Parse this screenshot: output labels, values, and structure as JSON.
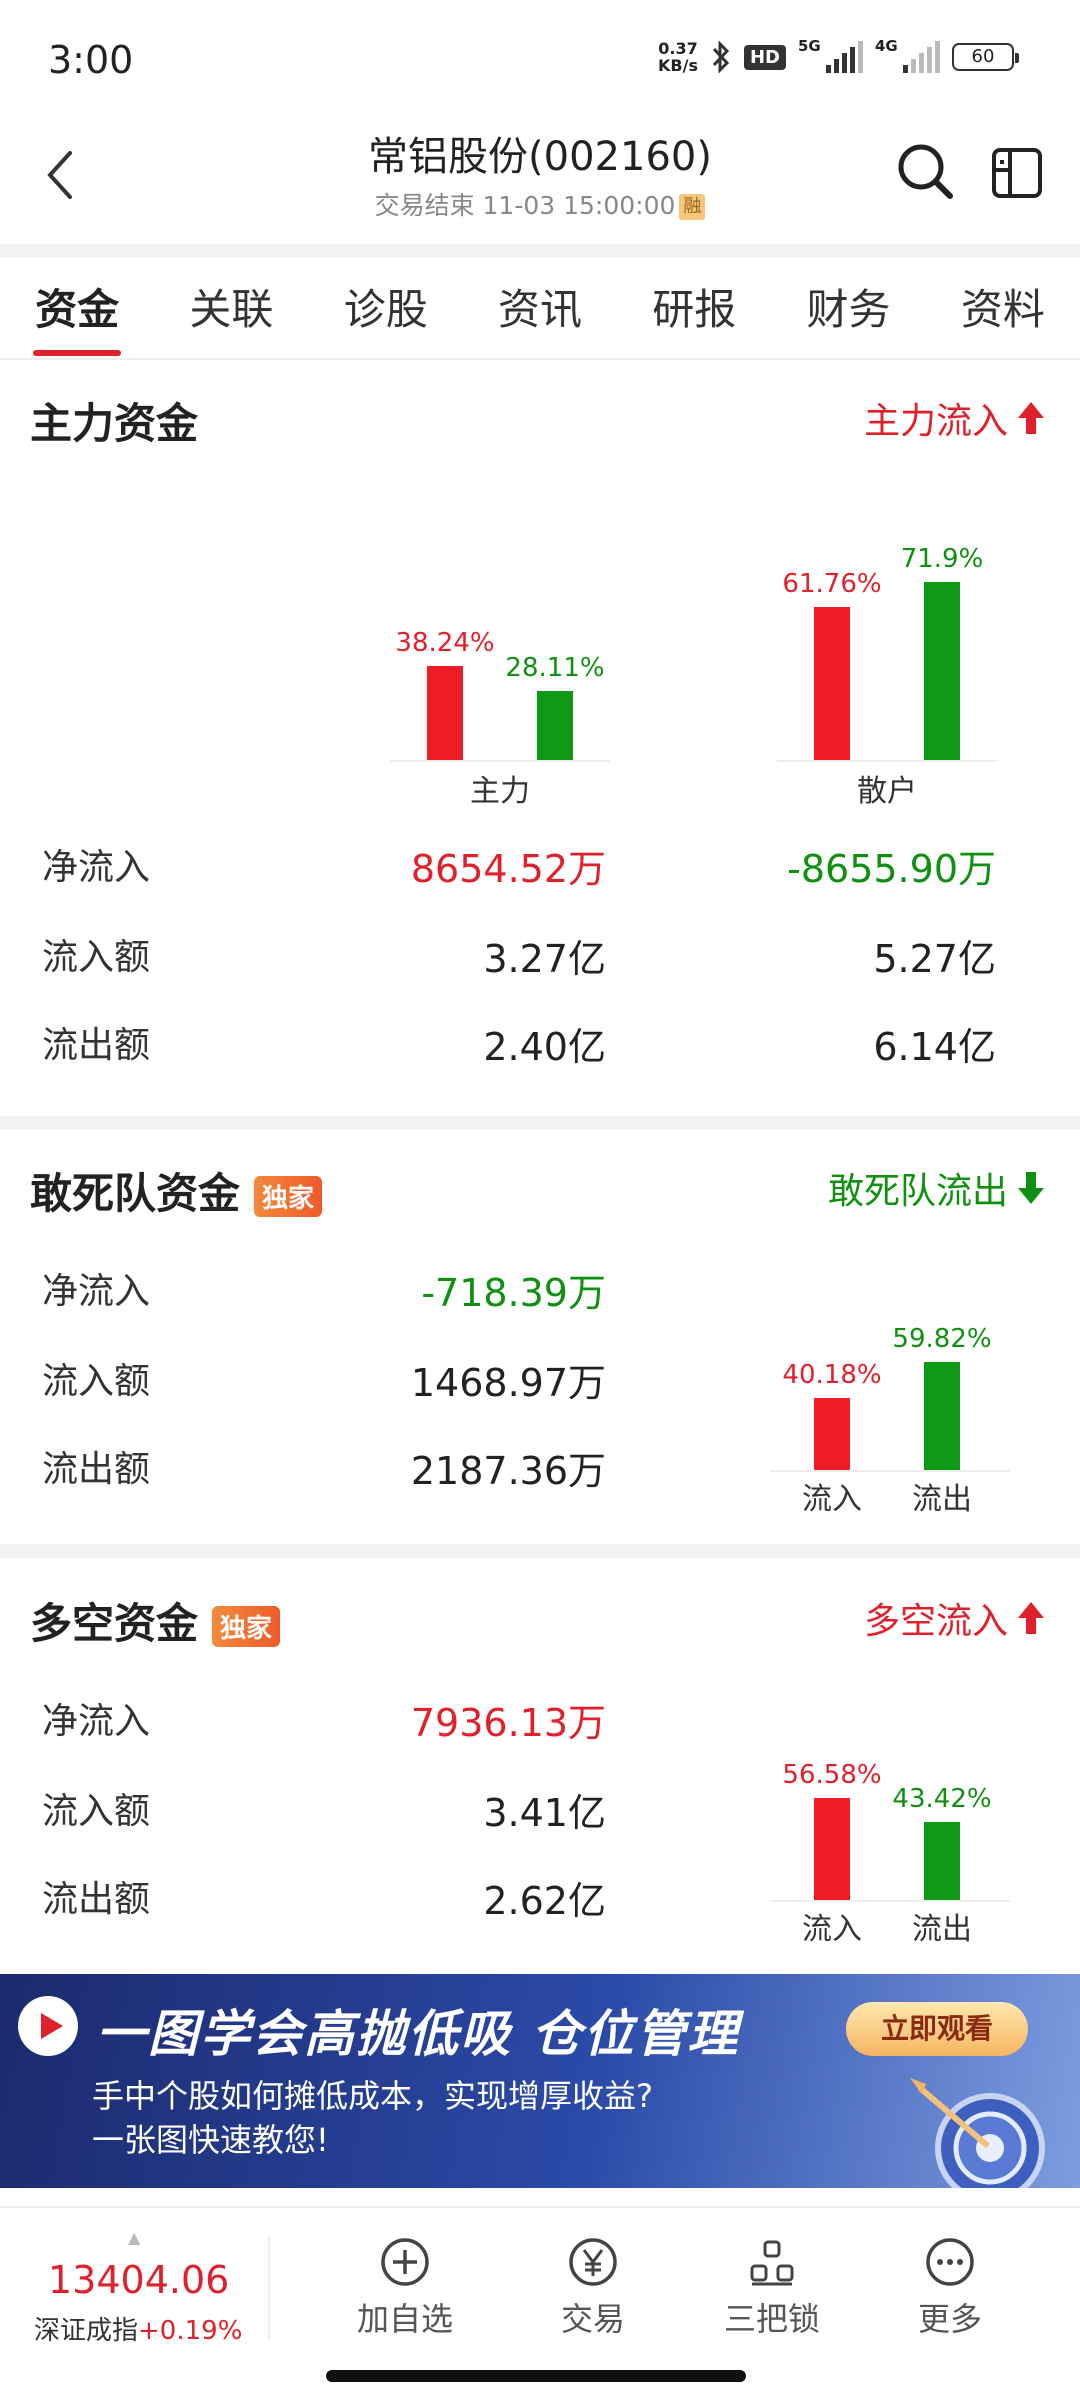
{
  "status_bar": {
    "time": "3:00",
    "net_speed": "0.37",
    "net_unit": "KB/s",
    "hd_label": "HD",
    "sim1": "5G",
    "sim2": "4G",
    "battery": "60"
  },
  "header": {
    "title": "常铝股份(002160)",
    "subtitle": "交易结束 11-03 15:00:00",
    "rong_badge": "融"
  },
  "tabs": [
    "资金",
    "关联",
    "诊股",
    "资讯",
    "研报",
    "财务",
    "资料"
  ],
  "main_fund": {
    "title": "主力资金",
    "flow_label": "主力流入",
    "chart_data": {
      "type": "bar",
      "categories": [
        "主力",
        "散户"
      ],
      "series": [
        {
          "values": [
            38.24,
            61.76
          ],
          "color": "#ee1c24"
        },
        {
          "values": [
            28.11,
            71.9
          ],
          "color": "#0e9a16"
        }
      ],
      "labels": [
        [
          "38.24%",
          "28.11%"
        ],
        [
          "61.76%",
          "71.9%"
        ]
      ]
    },
    "rows": [
      {
        "label": "净流入",
        "main": "8654.52万",
        "retail": "-8655.90万"
      },
      {
        "label": "流入额",
        "main": "3.27亿",
        "retail": "5.27亿"
      },
      {
        "label": "流出额",
        "main": "2.40亿",
        "retail": "6.14亿"
      }
    ]
  },
  "dare_fund": {
    "title": "敢死队资金",
    "badge": "独家",
    "flow_label": "敢死队流出",
    "rows": [
      {
        "label": "净流入",
        "value": "-718.39万"
      },
      {
        "label": "流入额",
        "value": "1468.97万"
      },
      {
        "label": "流出额",
        "value": "2187.36万"
      }
    ],
    "chart_data": {
      "type": "bar",
      "categories": [
        "流入",
        "流出"
      ],
      "values": [
        40.18,
        59.82
      ],
      "labels": [
        "40.18%",
        "59.82%"
      ]
    }
  },
  "longshort_fund": {
    "title": "多空资金",
    "badge": "独家",
    "flow_label": "多空流入",
    "rows": [
      {
        "label": "净流入",
        "value": "7936.13万"
      },
      {
        "label": "流入额",
        "value": "3.41亿"
      },
      {
        "label": "流出额",
        "value": "2.62亿"
      }
    ],
    "chart_data": {
      "type": "bar",
      "categories": [
        "流入",
        "流出"
      ],
      "values": [
        56.58,
        43.42
      ],
      "labels": [
        "56.58%",
        "43.42%"
      ]
    }
  },
  "banner": {
    "title": "一图学会高抛低吸 仓位管理",
    "sub1": "手中个股如何摊低成本，实现增厚收益?",
    "sub2": "一张图快速教您!",
    "button": "立即观看"
  },
  "bottom_bar": {
    "index_value": "13404.06",
    "index_name": "深证成指",
    "index_change": "+0.19%",
    "nav": [
      {
        "label": "加自选",
        "icon": "plus-circle-icon"
      },
      {
        "label": "交易",
        "icon": "yen-circle-icon"
      },
      {
        "label": "三把锁",
        "icon": "locks-icon"
      },
      {
        "label": "更多",
        "icon": "more-dots-icon"
      }
    ]
  },
  "colors": {
    "red": "#e0202a",
    "green": "#109010",
    "bar_red": "#ee1c24",
    "bar_green": "#0e9a16"
  }
}
